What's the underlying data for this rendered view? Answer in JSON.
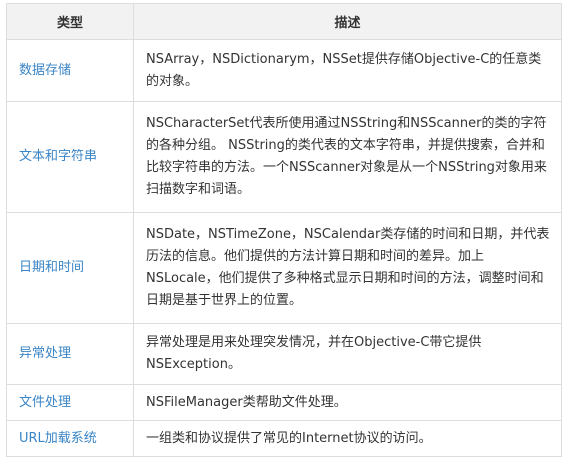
{
  "table": {
    "headers": [
      "类型",
      "描述"
    ],
    "rows": [
      {
        "type": "数据存储",
        "description": "NSArray，NSDictionarym，NSSet提供存储Objective-C的任意类的对象。"
      },
      {
        "type": "文本和字符串",
        "description": "NSCharacterSet代表所使用通过NSString和NSScanner的类的字符的各种分组。 NSString的类代表的文本字符串，并提供搜索，合并和比较字符串的方法。一个NSScanner对象是从一个NSString对象用来扫描数字和词语。"
      },
      {
        "type": "日期和时间",
        "description": "NSDate，NSTimeZone，NSCalendar类存储的时间和日期，并代表历法的信息。他们提供的方法计算日期和时间的差异。加上NSLocale，他们提供了多种格式显示日期和时间的方法，调整时间和日期是基于世界上的位置。"
      },
      {
        "type": "异常处理",
        "description": "异常处理是用来处理突发情况，并在Objective-C带它提供NSException。"
      },
      {
        "type": "文件处理",
        "description": "NSFileManager类帮助文件处理。"
      },
      {
        "type": "URL加载系统",
        "description": "一组类和协议提供了常见的Internet协议的访问。"
      }
    ]
  }
}
